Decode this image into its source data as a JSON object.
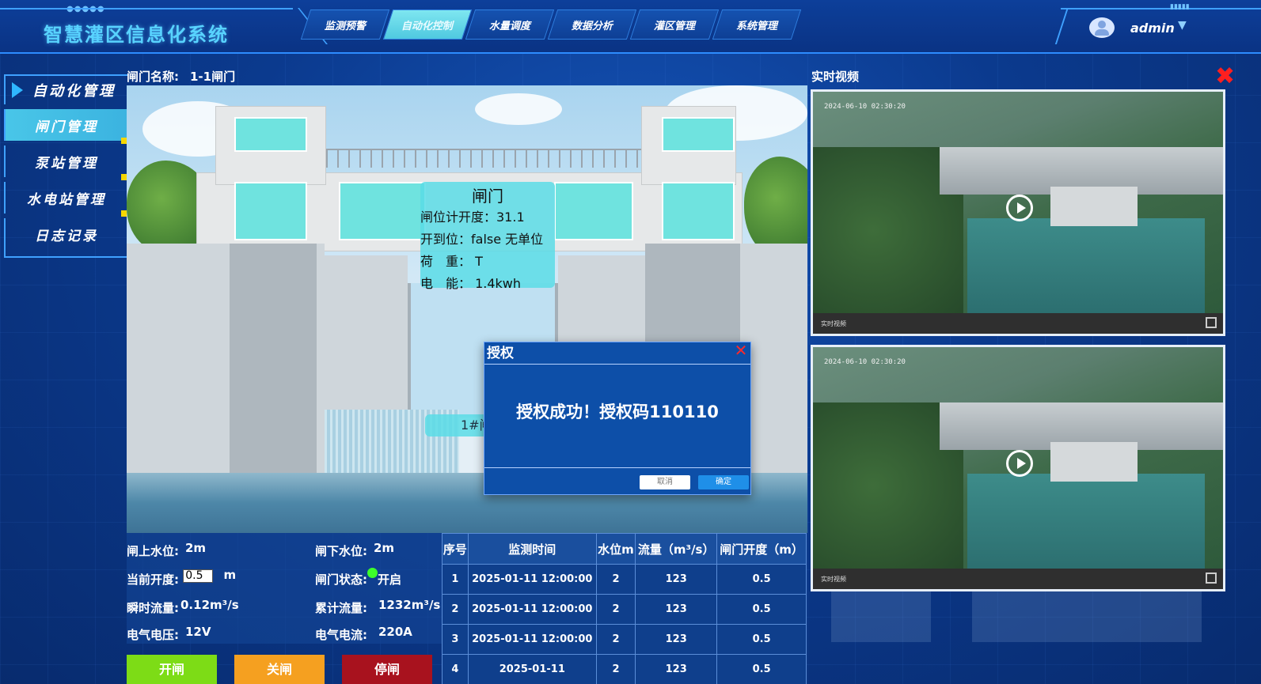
{
  "header": {
    "title": "智慧灌区信息化系统",
    "nav": [
      "监测预警",
      "自动化控制",
      "水量调度",
      "数据分析",
      "灌区管理",
      "系统管理"
    ],
    "active_nav": 1,
    "username": "admin"
  },
  "sidebar": {
    "title": "自动化管理",
    "items": [
      {
        "label": "闸门管理",
        "active": true
      },
      {
        "label": "泵站管理",
        "active": false
      },
      {
        "label": "水电站管理",
        "active": false
      },
      {
        "label": "日志记录",
        "active": false
      }
    ]
  },
  "gate": {
    "name_label": "闸门名称:",
    "name_value": "1-1闸门",
    "info_title": "闸门",
    "info_rows": [
      "闸位计开度：31.1",
      "开到位：false 无单位",
      "荷　重：  T",
      "电　能：  1.4kwh"
    ],
    "pill_text": "1#闸"
  },
  "dialog": {
    "title": "授权",
    "message": "授权成功！授权码110110",
    "cancel_label": "取消",
    "ok_label": "确定"
  },
  "status": {
    "upstream_label": "闸上水位:",
    "upstream_value": "2m",
    "downstream_label": "闸下水位:",
    "downstream_value": "2m",
    "opening_label": "当前开度:",
    "opening_value": "0.5",
    "opening_unit": "m",
    "gate_state_label": "闸门状态:",
    "gate_state_value": "开启",
    "inst_flow_label": "瞬时流量:",
    "inst_flow_value": "0.12m³/s",
    "cum_flow_label": "累计流量:",
    "cum_flow_value": "1232m³/s",
    "voltage_label": "电气电压:",
    "voltage_value": "12V",
    "current_label": "电气电流:",
    "current_value": "220A"
  },
  "actions": {
    "open_label": "开闸",
    "close_label": "关闸",
    "stop_label": "停闸",
    "open_color": "#7ddc16",
    "close_color": "#f5a020",
    "stop_color": "#a8121e"
  },
  "table": {
    "headers": [
      "序号",
      "监测时间",
      "水位m",
      "流量（m³/s）",
      "闸门开度（m）"
    ],
    "rows": [
      [
        "1",
        "2025-01-11 12:00:00",
        "2",
        "123",
        "0.5"
      ],
      [
        "2",
        "2025-01-11 12:00:00",
        "2",
        "123",
        "0.5"
      ],
      [
        "3",
        "2025-01-11 12:00:00",
        "2",
        "123",
        "0.5"
      ],
      [
        "4",
        "2025-01-11",
        "2",
        "123",
        "0.5"
      ]
    ]
  },
  "video": {
    "title": "实时视频",
    "timestamp": "2024-06-10 02:30:20",
    "live_label": "实时视频"
  }
}
